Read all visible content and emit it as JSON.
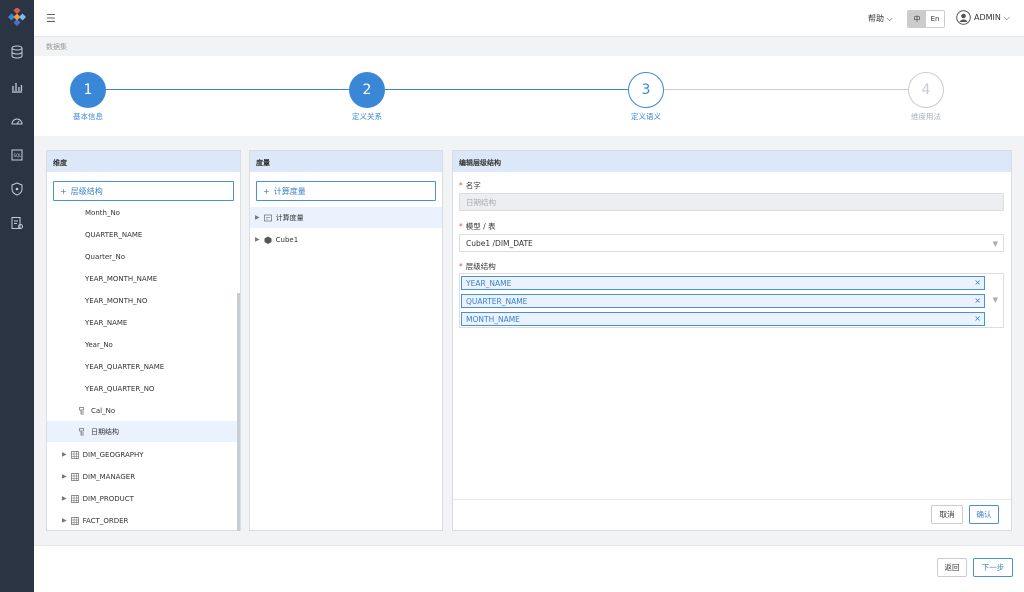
{
  "topbar": {
    "menu_icon": "menu-icon",
    "help": "帮助",
    "lang_zh": "中",
    "lang_en": "En",
    "user": "ADMIN"
  },
  "breadcrumb": "数据集",
  "steps": [
    {
      "num": "1",
      "label": "基本信息",
      "state": "done"
    },
    {
      "num": "2",
      "label": "定义关系",
      "state": "done"
    },
    {
      "num": "3",
      "label": "定义语义",
      "state": "active"
    },
    {
      "num": "4",
      "label": "维度用法",
      "state": "pending"
    }
  ],
  "dimensions": {
    "title": "维度",
    "add_label": "层级结构",
    "items": [
      "Month_No",
      "QUARTER_NAME",
      "Quarter_No",
      "YEAR_MONTH_NAME",
      "YEAR_MONTH_NO",
      "YEAR_NAME",
      "Year_No",
      "YEAR_QUARTER_NAME",
      "YEAR_QUARTER_NO"
    ],
    "hier_items": [
      "Cal_No",
      "日期结构"
    ],
    "tables": [
      "DIM_GEOGRAPHY",
      "DIM_MANAGER",
      "DIM_PRODUCT",
      "FACT_ORDER"
    ]
  },
  "measures": {
    "title": "度量",
    "add_label": "计算度量",
    "items": [
      "计算度量",
      "Cube1"
    ]
  },
  "editor": {
    "title": "编辑层级结构",
    "name_label": "名字",
    "name_placeholder": "日期结构",
    "model_label": "模型 / 表",
    "model_value": "Cube1 /DIM_DATE",
    "hier_label": "层级结构",
    "tags": [
      "YEAR_NAME",
      "QUARTER_NAME",
      "MONTH_NAME"
    ],
    "cancel": "取消",
    "confirm": "确认"
  },
  "footer": {
    "back": "返回",
    "next": "下一步"
  },
  "colors": {
    "accent": "#3a87d8",
    "sidebar": "#2b3442",
    "pending": "#c8ccd2"
  }
}
